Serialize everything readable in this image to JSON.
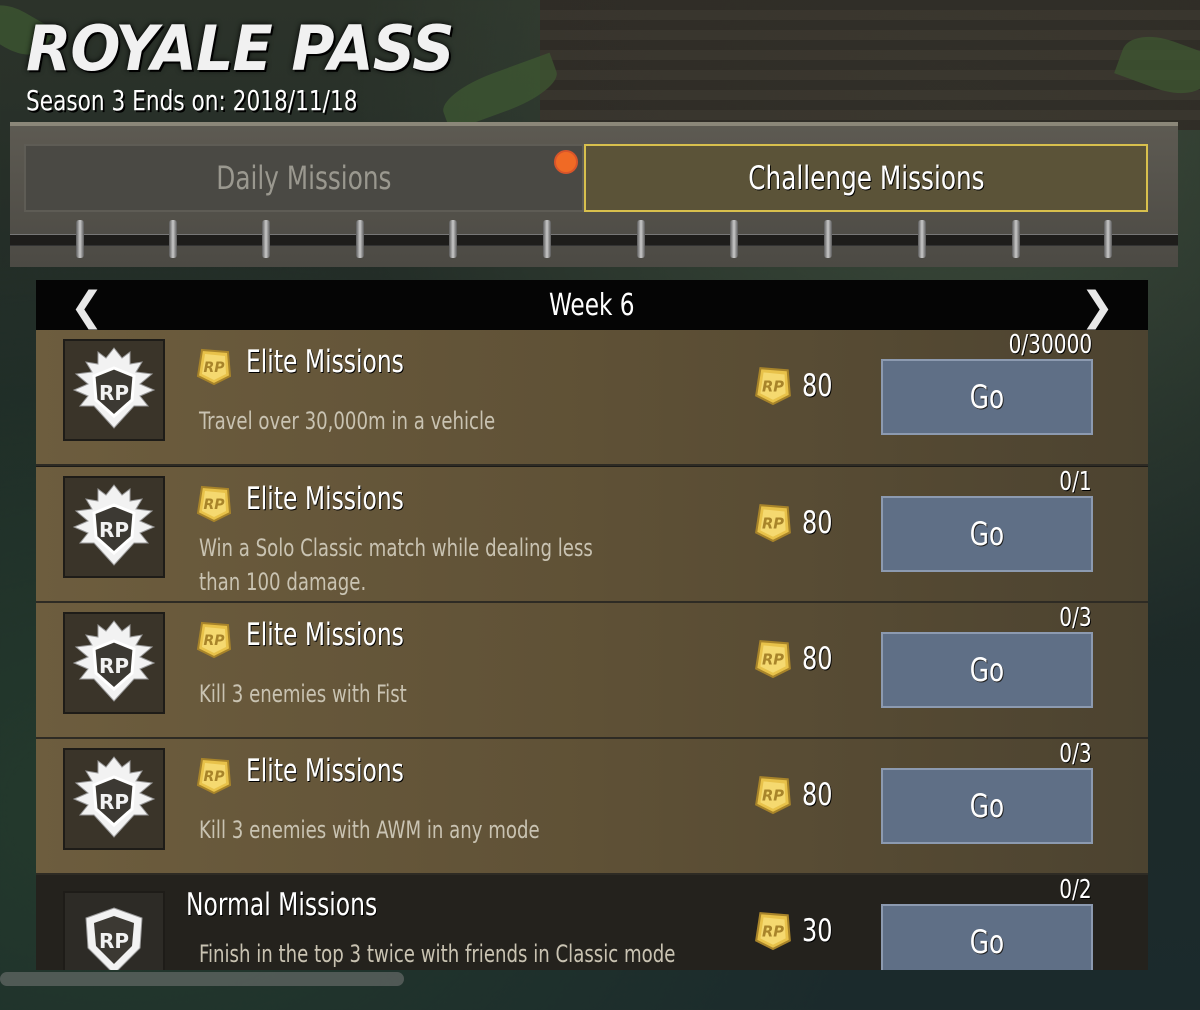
{
  "header": {
    "title": "ROYALE PASS",
    "season_text": "Season 3 Ends on: 2018/11/18"
  },
  "tabs": [
    {
      "label": "Daily Missions",
      "active": false,
      "has_notification": true
    },
    {
      "label": "Challenge Missions",
      "active": true
    }
  ],
  "week": {
    "label": "Week 6",
    "prev_icon": "chevron-left-icon",
    "next_icon": "chevron-right-icon"
  },
  "missions": [
    {
      "category": "Elite Missions",
      "type": "elite",
      "description": "Travel over 30,000m in a vehicle",
      "reward": "80",
      "progress": "0/30000",
      "button": "Go"
    },
    {
      "category": "Elite Missions",
      "type": "elite",
      "description": "Win a Solo Classic match while dealing less than 100 damage.",
      "reward": "80",
      "progress": "0/1",
      "button": "Go"
    },
    {
      "category": "Elite Missions",
      "type": "elite",
      "description": "Kill 3 enemies with Fist",
      "reward": "80",
      "progress": "0/3",
      "button": "Go"
    },
    {
      "category": "Elite Missions",
      "type": "elite",
      "description": "Kill 3 enemies with AWM in any mode",
      "reward": "80",
      "progress": "0/3",
      "button": "Go"
    },
    {
      "category": "Normal Missions",
      "type": "normal",
      "description": "Finish in the top 3 twice with friends in Classic mode",
      "reward": "30",
      "progress": "0/2",
      "button": "Go"
    }
  ],
  "colors": {
    "accent_gold": "#d8c04d",
    "go_button": "#5f6f86",
    "notification": "#f06a25",
    "elite_row": "#6d5d3e"
  }
}
